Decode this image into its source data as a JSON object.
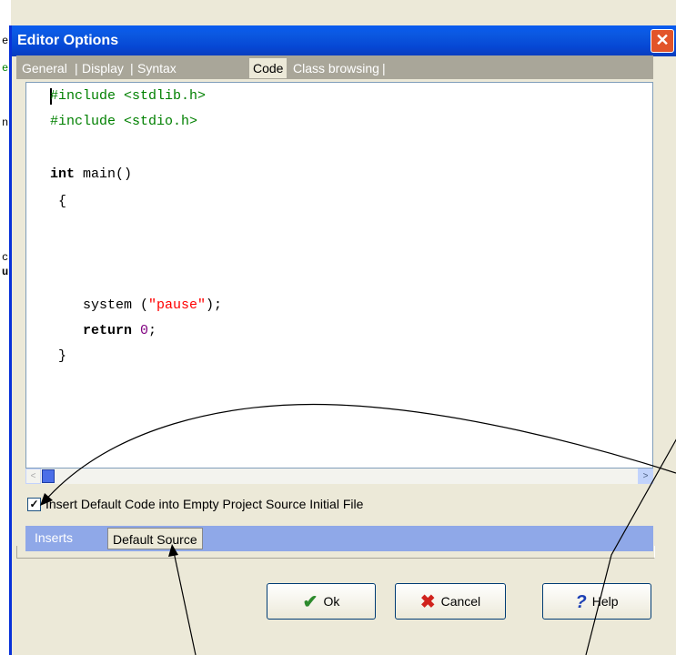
{
  "background": {
    "fragments": [
      "e",
      "e",
      "n",
      "c",
      "u"
    ]
  },
  "dialog": {
    "title": "Editor Options",
    "close_glyph": "✕",
    "tabs": [
      "General",
      "Display",
      "Syntax",
      "Code",
      "Class browsing"
    ],
    "active_tab": "Code",
    "editor": {
      "lines": [
        {
          "prefix": "",
          "pp": "#include <stdlib.h>"
        },
        {
          "prefix": "",
          "pp": "#include <stdio.h>"
        },
        {
          "kw": "int",
          "rest": " main()"
        },
        {
          "text": " {"
        },
        {
          "text": "    system (",
          "str": "\"pause\"",
          "after": ");"
        },
        {
          "kw": "    return",
          "num": "0",
          "after": ";"
        },
        {
          "text": " }"
        }
      ]
    },
    "checkbox": {
      "checked": true,
      "mark": "✓",
      "label": "Insert Default Code into Empty Project Source Initial File"
    },
    "bottom_tabs": [
      "Inserts",
      "Default Source"
    ],
    "buttons": {
      "ok": "Ok",
      "cancel": "Cancel",
      "help": "Help"
    },
    "scroll_left_glyph": "<",
    "scroll_right_glyph": ">"
  },
  "colors": {
    "titlebar": "#0a5cf0",
    "preprocessor": "#008000",
    "string": "#ff0000",
    "number": "#800080"
  }
}
